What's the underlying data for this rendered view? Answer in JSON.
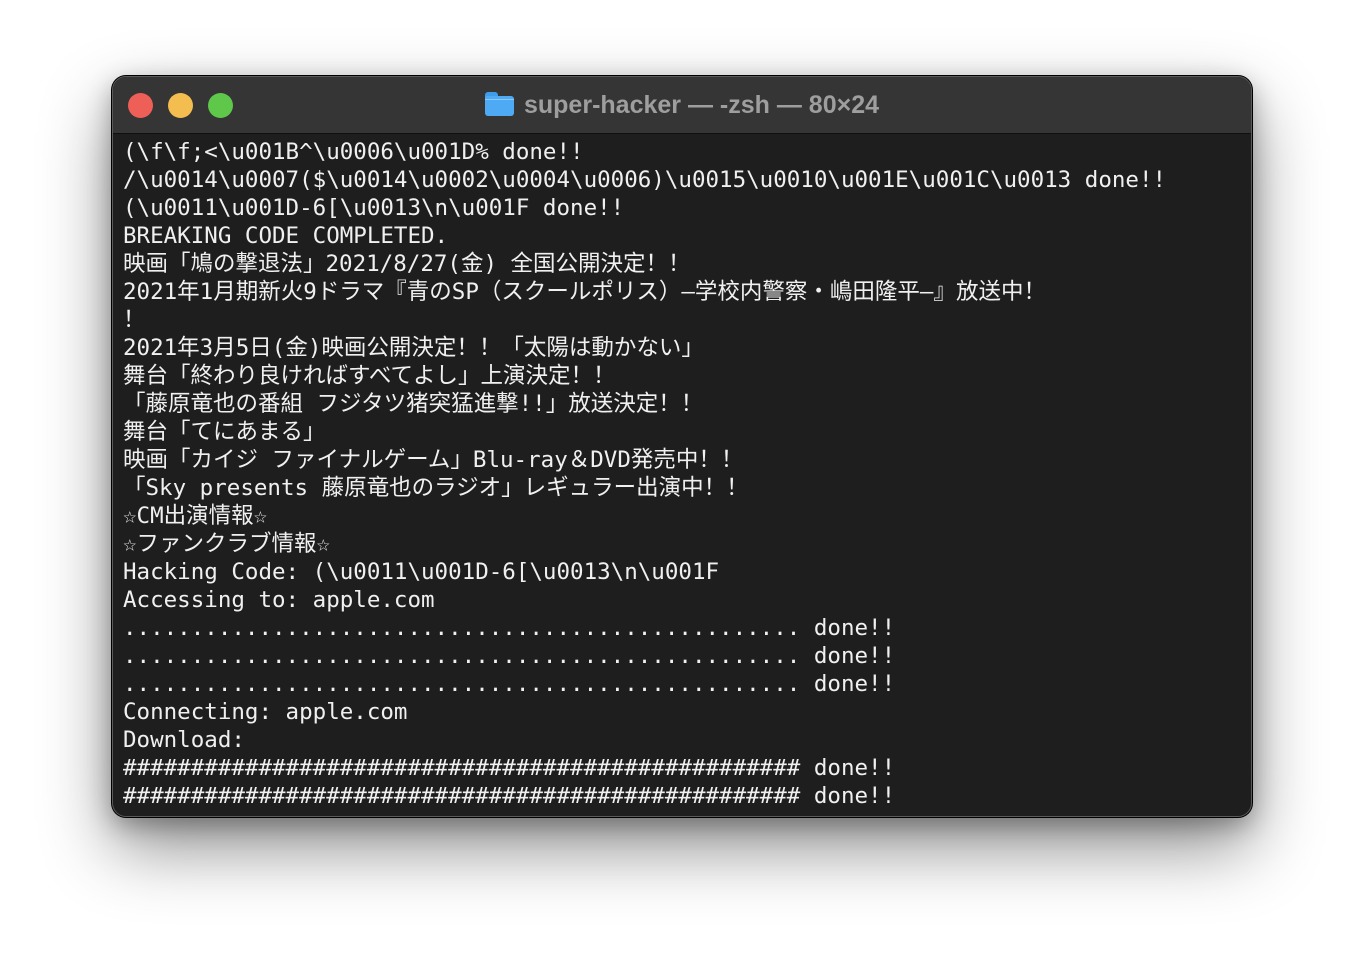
{
  "window": {
    "title": "super-hacker — -zsh — 80×24",
    "title_icon": "folder-icon",
    "traffic_colors": {
      "close": "#ee5f57",
      "minimize": "#f4bd4f",
      "maximize": "#5fc84a"
    }
  },
  "terminal": {
    "lines": [
      "(\\f\\f;<\\u001B^\\u0006\\u001D% done!!",
      "/\\u0014\\u0007($\\u0014\\u0002\\u0004\\u0006)\\u0015\\u0010\\u001E\\u001C\\u0013 done!!",
      "(\\u0011\\u001D-6[\\u0013\\n\\u001F done!!",
      "BREAKING CODE COMPLETED.",
      "映画「鳩の撃退法」2021/8/27(金) 全国公開決定！！",
      "2021年1月期新火9ドラマ『青のSP（スクールポリス）—学校内警察・嶋田隆平—』放送中！",
      "！",
      "2021年3月5日(金)映画公開決定！！「太陽は動かない」",
      "舞台「終わり良ければすべてよし」上演決定！！",
      "「藤原竜也の番組 フジタツ猪突猛進撃!!」放送決定！！",
      "舞台「てにあまる」",
      "映画「カイジ ファイナルゲーム」Blu-ray＆DVD発売中！！",
      "「Sky presents 藤原竜也のラジオ」レギュラー出演中！！",
      "☆CM出演情報☆",
      "☆ファンクラブ情報☆",
      "Hacking Code: (\\u0011\\u001D-6[\\u0013\\n\\u001F",
      "Accessing to: apple.com",
      ".................................................. done!!",
      ".................................................. done!!",
      ".................................................. done!!",
      "Connecting: apple.com",
      "Download:",
      "################################################## done!!",
      "################################################## done!!"
    ]
  }
}
